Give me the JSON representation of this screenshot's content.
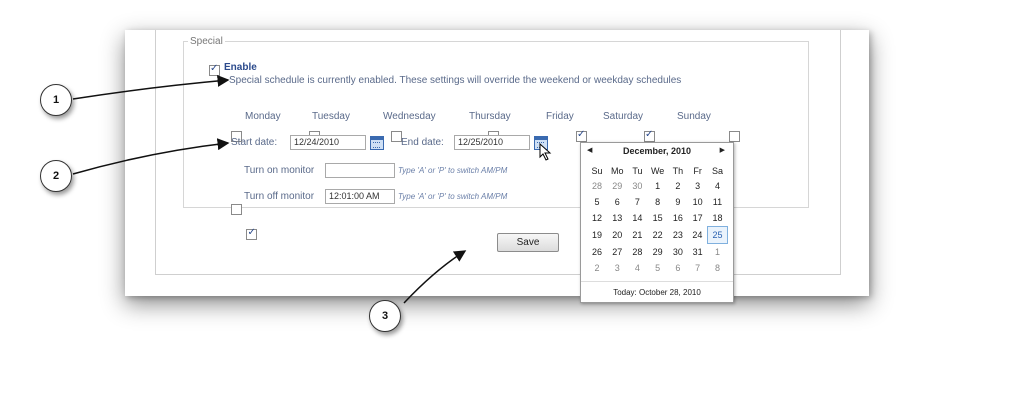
{
  "special": {
    "legend": "Special",
    "enable_label": "Enable",
    "status_text": "Special schedule is currently enabled. These settings will override the weekend or weekday schedules",
    "days": [
      {
        "label": "Monday",
        "checked": false
      },
      {
        "label": "Tuesday",
        "checked": false
      },
      {
        "label": "Wednesday",
        "checked": false
      },
      {
        "label": "Thursday",
        "checked": false
      },
      {
        "label": "Friday",
        "checked": true
      },
      {
        "label": "Saturday",
        "checked": true
      },
      {
        "label": "Sunday",
        "checked": false
      }
    ],
    "start_date_label": "Start date:",
    "start_date_value": "12/24/2010",
    "end_date_label": "End date:",
    "end_date_value": "12/25/2010",
    "turn_on_label": "Turn on monitor",
    "turn_on_value": "",
    "turn_off_label": "Turn off monitor",
    "turn_off_value": "12:01:00 AM",
    "hint": "Type 'A' or 'P' to switch AM/PM"
  },
  "save_label": "Save",
  "calendar": {
    "month_label": "December, 2010",
    "weekdays": [
      "Su",
      "Mo",
      "Tu",
      "We",
      "Th",
      "Fr",
      "Sa"
    ],
    "weeks": [
      [
        "28",
        "29",
        "30",
        "1",
        "2",
        "3",
        "4"
      ],
      [
        "5",
        "6",
        "7",
        "8",
        "9",
        "10",
        "11"
      ],
      [
        "12",
        "13",
        "14",
        "15",
        "16",
        "17",
        "18"
      ],
      [
        "19",
        "20",
        "21",
        "22",
        "23",
        "24",
        "25"
      ],
      [
        "26",
        "27",
        "28",
        "29",
        "30",
        "31",
        "1"
      ],
      [
        "2",
        "3",
        "4",
        "5",
        "6",
        "7",
        "8"
      ]
    ],
    "selected": "25",
    "today_label": "Today: October 28, 2010"
  },
  "callouts": [
    "1",
    "2",
    "3"
  ]
}
